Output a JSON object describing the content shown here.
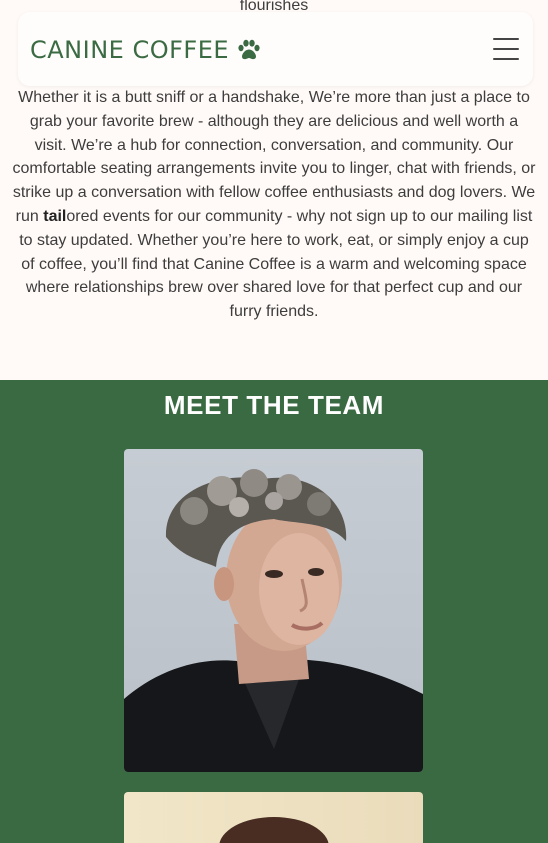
{
  "peek_text": "flourishes",
  "header": {
    "brand": "CANINE COFFEE",
    "brand_icon": "paw-icon",
    "menu_icon": "hamburger-menu-icon"
  },
  "about": {
    "part1": "Whether it is a butt sniff or a handshake, We’re more than just a place to grab your favorite brew - although they are delicious and well worth a visit. We’re a hub for connection, conversation, and community. Our comfortable seating arrangements invite you to linger, chat with friends, or strike up a conversation with fellow coffee enthusiasts and dog lovers. We run ",
    "bold": "tail",
    "part2": "ored events for our community - why not sign up to our mailing list to stay updated. Whether you’re here to work, eat, or simply enjoy a cup of coffee, you’ll find that Canine Coffee is a warm and welcoming space where relationships brew over shared love for that perfect cup and our furry friends."
  },
  "team": {
    "title": "MEET THE TEAM"
  },
  "colors": {
    "brand_green": "#3b6b43",
    "team_bg": "#3a6a42",
    "page_bg": "#fffaf7"
  }
}
